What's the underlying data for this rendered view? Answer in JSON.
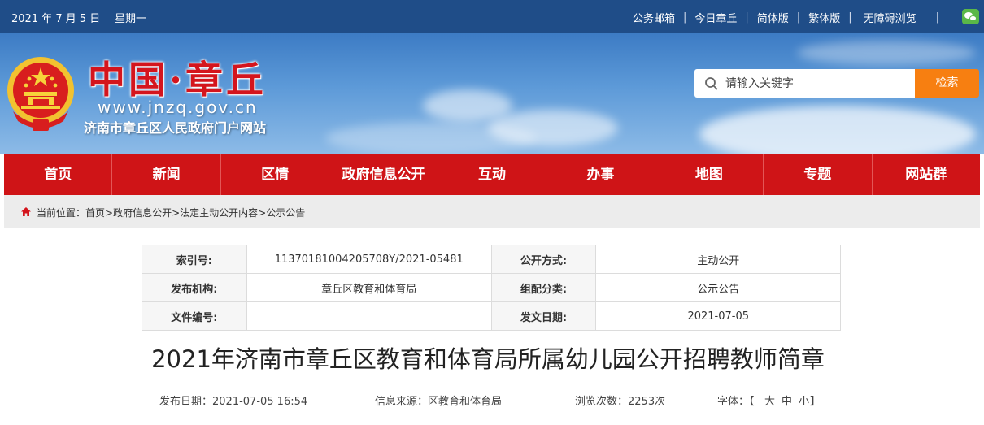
{
  "topbar": {
    "date": "2021 年 7 月 5 日",
    "weekday": "星期一",
    "links": [
      "公务邮箱",
      "今日章丘",
      "简体版",
      "繁体版",
      "无障碍浏览"
    ],
    "separator": "|",
    "wechat_icon": "wechat-icon"
  },
  "header": {
    "logo_title": "中国·章丘",
    "logo_url": "www.jnzq.gov.cn",
    "logo_subtitle": "济南市章丘区人民政府门户网站",
    "search": {
      "placeholder": "请输入关键字",
      "button": "检索"
    }
  },
  "nav": {
    "items": [
      "首页",
      "新闻",
      "区情",
      "政府信息公开",
      "互动",
      "办事",
      "地图",
      "专题",
      "网站群"
    ]
  },
  "breadcrumb": {
    "prefix": "当前位置：",
    "items": [
      "首页",
      "政府信息公开",
      "法定主动公开内容",
      "公示公告"
    ],
    "separator": ">"
  },
  "info": {
    "rows": [
      {
        "k1": "索引号:",
        "v1": "11370181004205708Y/2021-05481",
        "k2": "公开方式:",
        "v2": "主动公开"
      },
      {
        "k1": "发布机构:",
        "v1": "章丘区教育和体育局",
        "k2": "组配分类:",
        "v2": "公示公告"
      },
      {
        "k1": "文件编号:",
        "v1": "",
        "k2": "发文日期:",
        "v2": "2021-07-05"
      }
    ]
  },
  "article": {
    "title": "2021年济南市章丘区教育和体育局所属幼儿园公开招聘教师简章",
    "publish_date": "发布日期：2021-07-05 16:54",
    "source": "信息来源：区教育和体育局",
    "views": "浏览次数：2253次",
    "font_label": "字体：【",
    "font_sizes": [
      "大",
      "中",
      "小"
    ],
    "font_close": "】"
  },
  "colors": {
    "topbar": "#1f4d88",
    "nav": "#cf1417",
    "search_button": "#f77f11",
    "logo_red": "#d4151d"
  }
}
